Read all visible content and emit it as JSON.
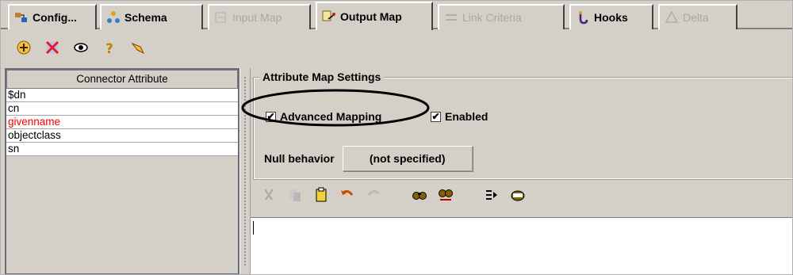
{
  "tabs": [
    {
      "label": "Config...",
      "icon": "config-icon",
      "state": "normal"
    },
    {
      "label": "Schema",
      "icon": "schema-icon",
      "state": "normal"
    },
    {
      "label": "Input Map",
      "icon": "input-map-icon",
      "state": "disabled"
    },
    {
      "label": "Output Map",
      "icon": "output-map-icon",
      "state": "active"
    },
    {
      "label": "Link Criteria",
      "icon": "link-criteria-icon",
      "state": "disabled"
    },
    {
      "label": "Hooks",
      "icon": "hooks-icon",
      "state": "normal"
    },
    {
      "label": "Delta",
      "icon": "delta-icon",
      "state": "disabled"
    }
  ],
  "toolbar": {
    "icons": [
      "add-attribute-icon",
      "delete-attribute-icon",
      "view-icon",
      "help-icon",
      "pointer-icon"
    ]
  },
  "attribute_list": {
    "header": "Connector Attribute",
    "items": [
      {
        "label": "$dn",
        "highlight": false
      },
      {
        "label": "cn",
        "highlight": false
      },
      {
        "label": "givenname",
        "highlight": true
      },
      {
        "label": "objectclass",
        "highlight": false
      },
      {
        "label": "sn",
        "highlight": false
      }
    ]
  },
  "settings": {
    "title": "Attribute Map Settings",
    "advanced_mapping_label": "Advanced Mapping",
    "advanced_mapping_checked": true,
    "enabled_label": "Enabled",
    "enabled_checked": true,
    "null_behavior_label": "Null behavior",
    "null_behavior_value": "(not specified)"
  },
  "map_toolbar": {
    "icons": [
      "cut-icon",
      "copy-icon",
      "paste-icon",
      "undo-icon",
      "redo-icon",
      "find-icon",
      "find-next-icon",
      "insert-icon",
      "edit-icon"
    ]
  },
  "colors": {
    "background": "#d4d0c8",
    "highlight_text": "#ff0000"
  }
}
